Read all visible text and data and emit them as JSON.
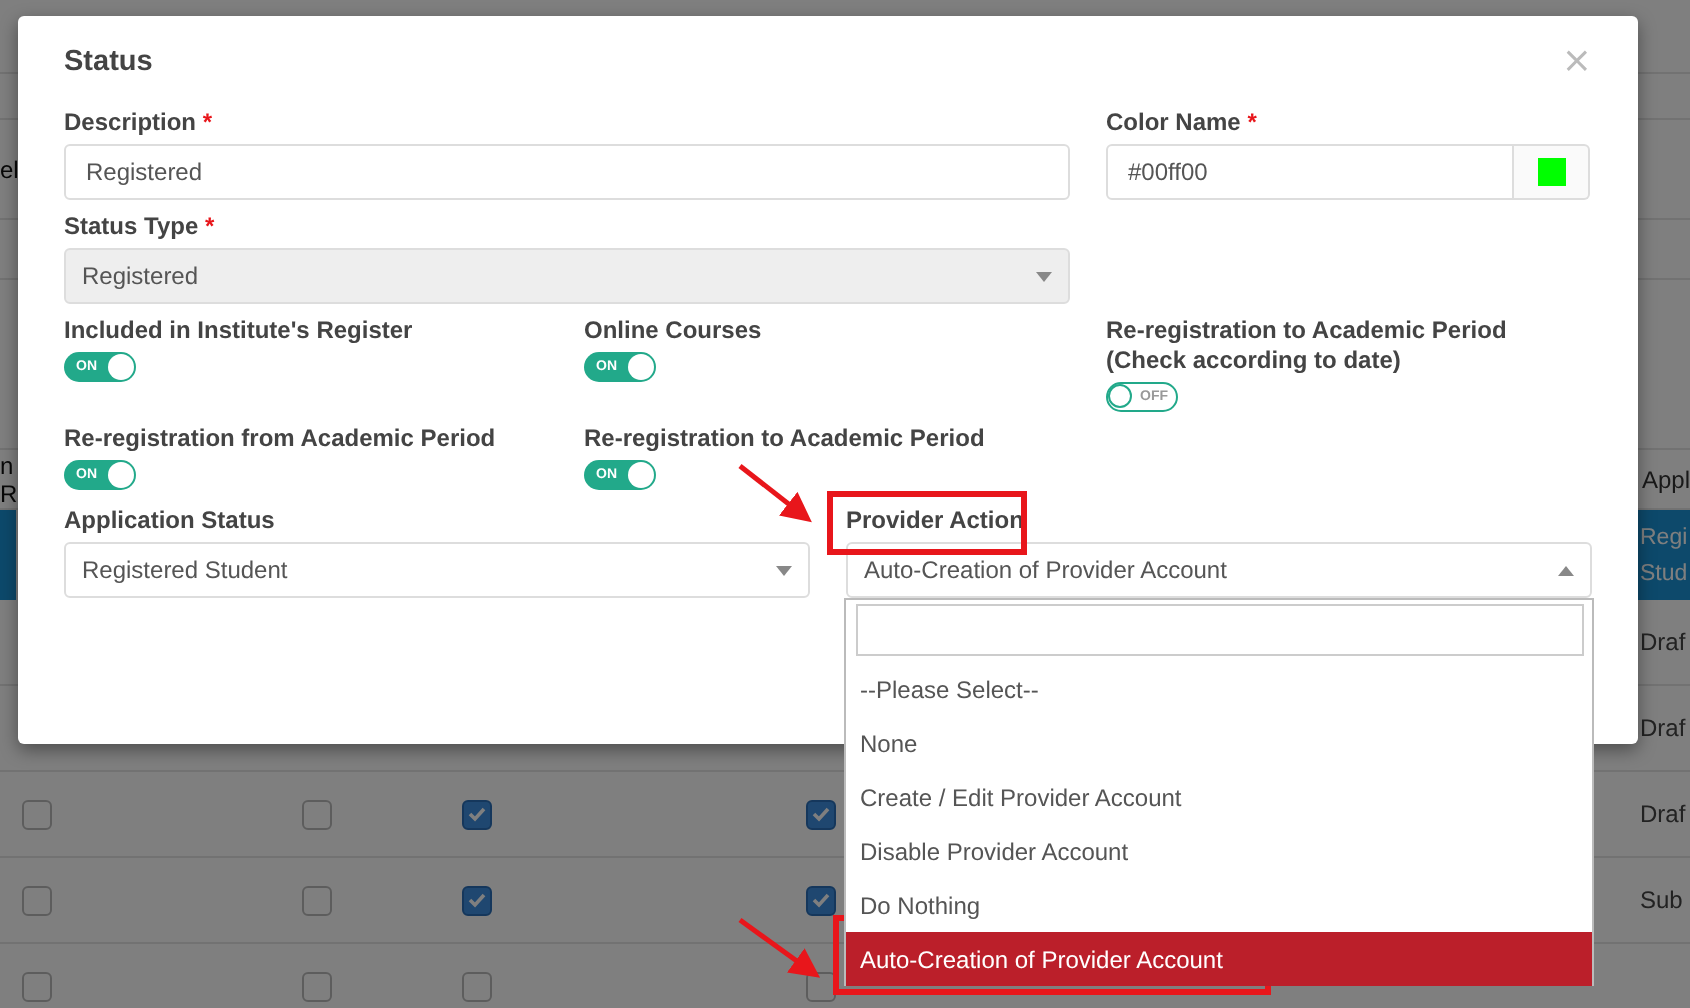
{
  "page_behind": {
    "cut_label": "el",
    "header_left": [
      "n",
      "R"
    ],
    "header_right": "Appl",
    "highlighted_row": [
      "Regi",
      "Stud"
    ],
    "rows": [
      {
        "status": "Draf"
      },
      {
        "status": "Draf"
      },
      {
        "checks": [
          false,
          false,
          true,
          true
        ],
        "status": "Draf"
      },
      {
        "checks": [
          false,
          false,
          true,
          true
        ],
        "status": "Sub"
      },
      {
        "checks": [
          false,
          false,
          false,
          false
        ]
      }
    ]
  },
  "dialog": {
    "title": "Status",
    "close": "×",
    "description": {
      "label": "Description",
      "required_mark": "*",
      "value": "Registered"
    },
    "color_name": {
      "label": "Color Name",
      "required_mark": "*",
      "value": "#00ff00",
      "color": "#00ff00"
    },
    "status_type": {
      "label": "Status Type",
      "required_mark": "*",
      "value": "Registered",
      "disabled": true
    },
    "toggles": [
      {
        "label": "Included in Institute's Register",
        "on": true,
        "text": "ON"
      },
      {
        "label": "Online Courses",
        "on": true,
        "text": "ON"
      },
      {
        "label": "Re-registration to Academic Period (Check according to date)",
        "on": false,
        "text": "OFF"
      },
      {
        "label": "Re-registration from Academic Period",
        "on": true,
        "text": "ON"
      },
      {
        "label": "Re-registration to Academic Period",
        "on": true,
        "text": "ON"
      }
    ],
    "application_status": {
      "label": "Application Status",
      "value": "Registered Student"
    },
    "provider_action": {
      "label": "Provider Action",
      "value": "Auto-Creation of Provider Account",
      "expanded": true,
      "options": [
        {
          "label": "--Please Select--",
          "selected": false
        },
        {
          "label": "None",
          "selected": false
        },
        {
          "label": "Create / Edit Provider Account",
          "selected": false
        },
        {
          "label": "Disable Provider Account",
          "selected": false
        },
        {
          "label": "Do Nothing",
          "selected": false
        },
        {
          "label": "Auto-Creation of Provider Account",
          "selected": true
        }
      ]
    }
  }
}
